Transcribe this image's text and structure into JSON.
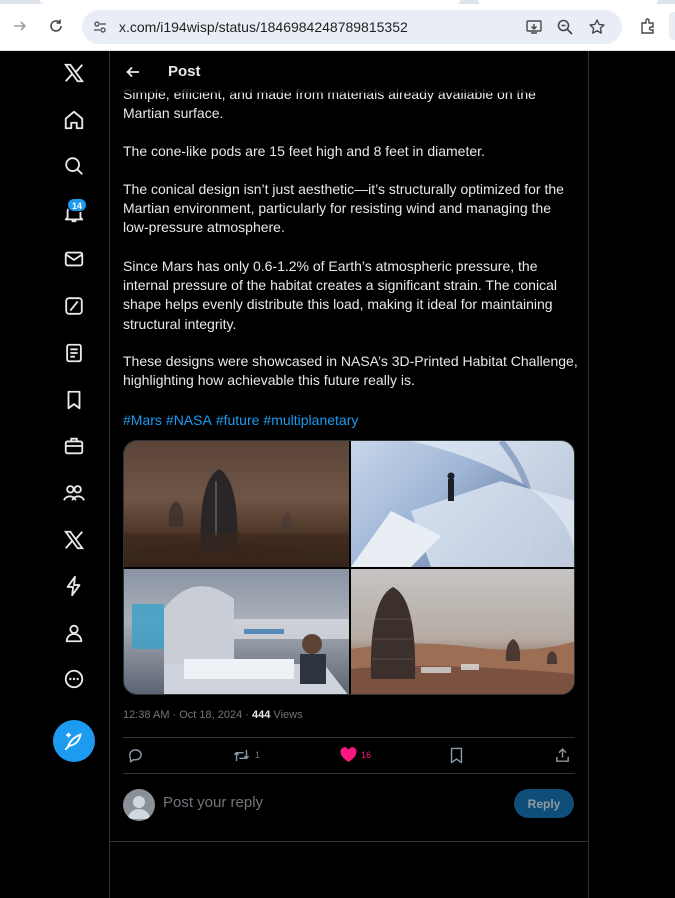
{
  "browser": {
    "url": "x.com/i194wisp/status/1846984248789815352"
  },
  "leftnav": {
    "notifications_badge": "14",
    "items": [
      "x-logo-icon",
      "home-icon",
      "search-icon",
      "notifications-icon",
      "messages-icon",
      "grok-icon",
      "lists-icon",
      "bookmarks-icon",
      "jobs-icon",
      "communities-icon",
      "premium-icon",
      "verified-orgs-icon",
      "profile-icon",
      "more-icon"
    ]
  },
  "header": {
    "title": "Post"
  },
  "post": {
    "paragraphs": [
      "Simple, efficient, and made from materials already available on the Martian surface.",
      "The cone-like pods are 15 feet high and 8 feet in diameter.",
      "The conical design isn’t just aesthetic—it’s structurally optimized for the Martian environment, particularly for resisting wind and managing the low-pressure atmosphere.",
      "Since Mars has only 0.6-1.2% of Earth’s atmospheric pressure, the internal pressure of the habitat creates a significant strain. The conical shape helps evenly distribute this load, making it ideal for maintaining structural integrity.",
      "These designs were showcased in NASA’s 3D-Printed Habitat Challenge, highlighting how achievable this future really is."
    ],
    "hashtags": [
      "#Mars",
      "#NASA",
      "#future",
      "#multiplanetary"
    ],
    "time": "12:38 AM · Oct 18, 2024 · ",
    "views_count": "444",
    "views_label": " Views",
    "actions": {
      "reply_count": "",
      "repost_count": "1",
      "like_count": "16"
    }
  },
  "reply": {
    "placeholder": "Post your reply",
    "button": "Reply"
  },
  "colors": {
    "accent": "#1d9bf0",
    "like": "#f91880",
    "background": "#000000"
  }
}
